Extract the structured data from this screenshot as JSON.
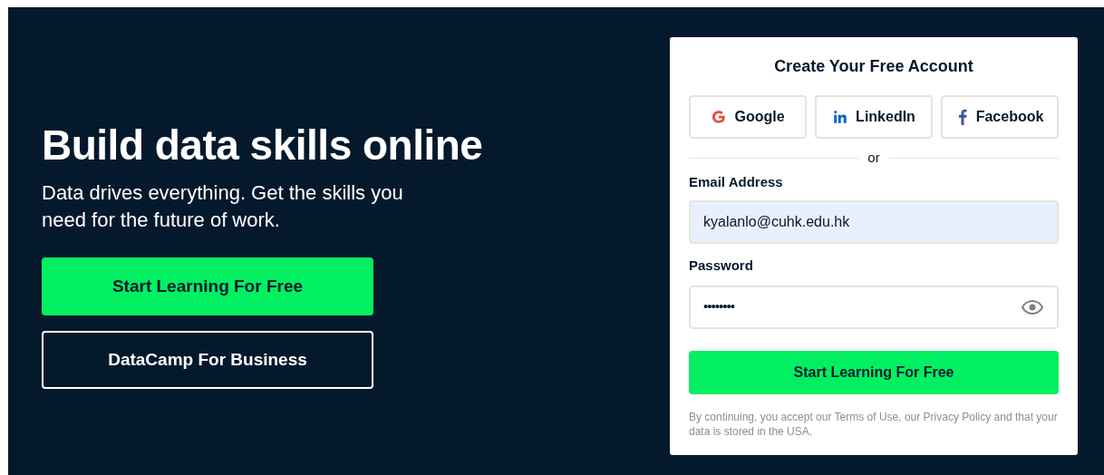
{
  "hero": {
    "title": "Build data skills online",
    "subtitle": "Data drives everything. Get the skills you need for the future of work.",
    "buttons": [
      {
        "label": "Start Learning For Free",
        "kind": "primary"
      },
      {
        "label": "DataCamp For Business",
        "kind": "outline"
      }
    ]
  },
  "signup": {
    "title": "Create Your Free Account",
    "social": [
      {
        "label": "Google",
        "kind": "google"
      },
      {
        "label": "LinkedIn",
        "kind": "linkedin"
      },
      {
        "label": "Facebook",
        "kind": "facebook"
      }
    ],
    "divider": "or",
    "email": {
      "label": "Email Address",
      "value": "kyalanlo@cuhk.edu.hk"
    },
    "password": {
      "label": "Password",
      "value": "••••••••"
    },
    "submit": "Start Learning For Free",
    "legal": "By continuing, you accept our Terms of Use, our Privacy Policy and that your data is stored in the USA."
  }
}
